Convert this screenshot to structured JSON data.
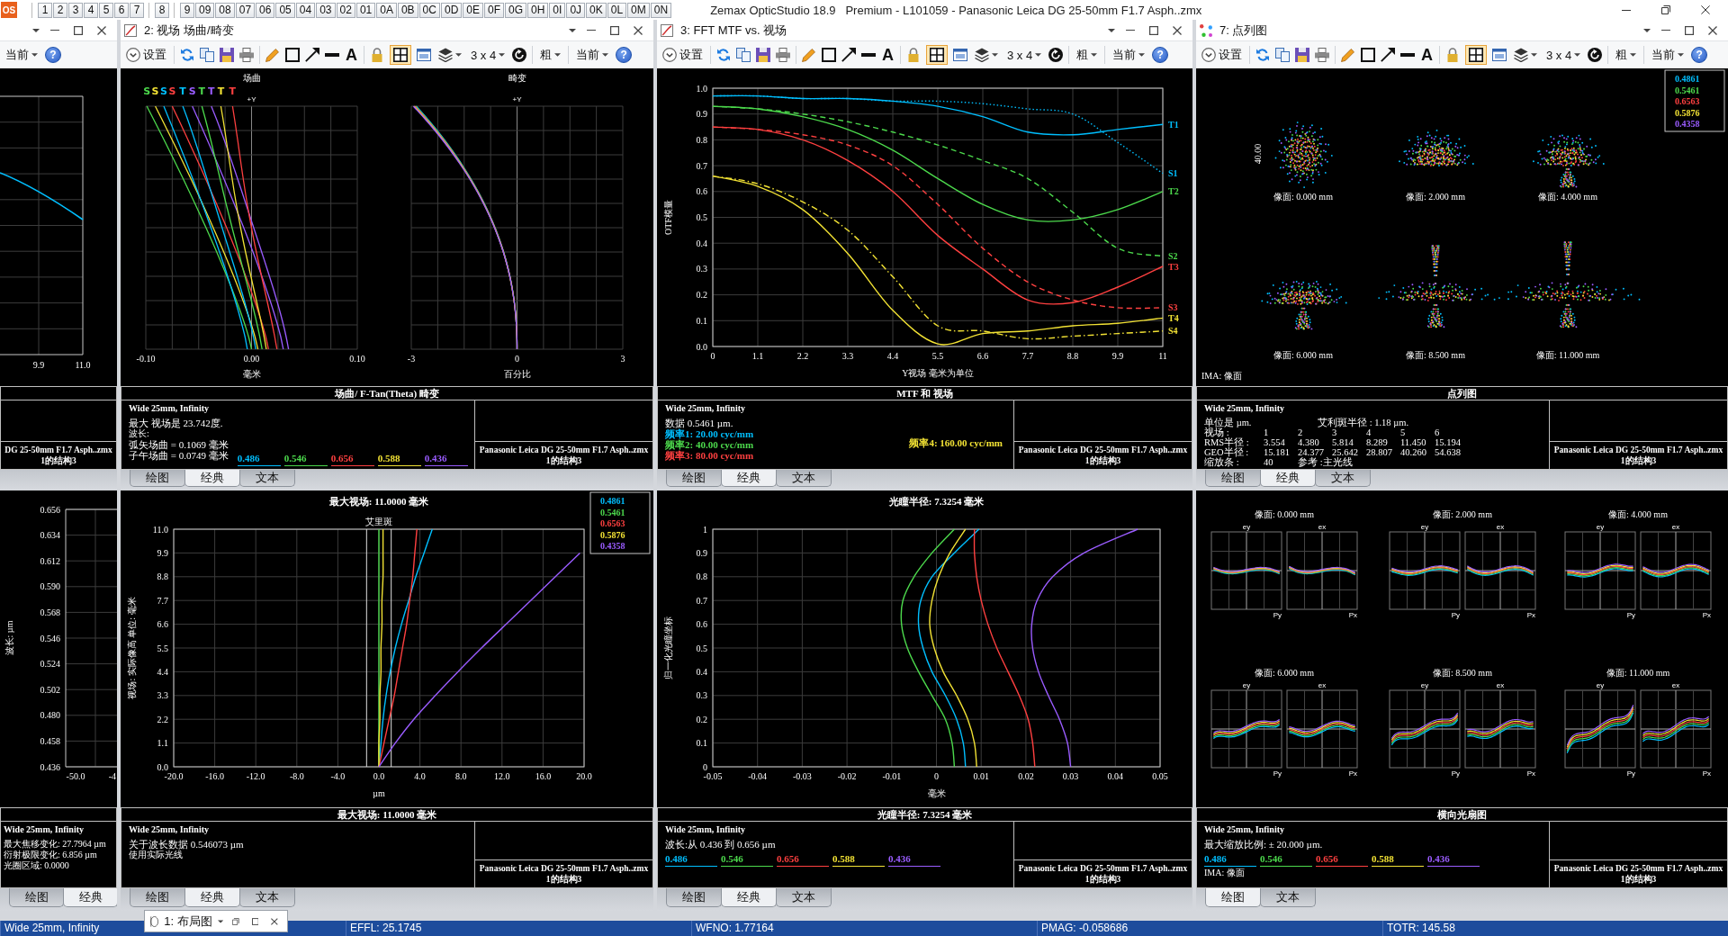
{
  "window": {
    "logo": "OS",
    "title": "Zemax OpticStudio 18.9   Premium - L101059 - Panasonic Leica DG 25-50mm F1.7 Asph..zmx"
  },
  "tab_groups": [
    [
      "1",
      "2",
      "3",
      "4",
      "5",
      "6",
      "7"
    ],
    [
      "8"
    ],
    [
      "9",
      "09",
      "08",
      "07",
      "06",
      "05",
      "04",
      "03",
      "02",
      "01",
      "0A",
      "0B",
      "0C",
      "0D",
      "0E",
      "0F",
      "0G",
      "0H",
      "0I",
      "0J",
      "0K",
      "0L",
      "0M",
      "0N"
    ]
  ],
  "panes": [
    {
      "kind": "with-header",
      "toolbar": {
        "kind": "partial",
        "config": "当前",
        "help": "?"
      },
      "chart": {
        "kind": "partial-curve",
        "curves": [
          {
            "color": "#00bfff"
          }
        ],
        "xticks": [
          "9.9",
          "11.0"
        ]
      },
      "info": {
        "file": "DG 25-50mm F1.7 Asph..zmx",
        "config": "1的结构3"
      }
    },
    {
      "kind": "with-header",
      "title": "2: 视场 场曲/畸变",
      "toolbar": {
        "kind": "full",
        "settings": "设置",
        "text_tool": "A",
        "layout": "3 x 4",
        "weight": "粗",
        "config": "当前",
        "help": "?",
        "snap_on": true
      },
      "chart": {
        "kind": "field-curvature",
        "panels": [
          {
            "title": "场曲",
            "axis": "+Y",
            "xticks": [
              "-0.10",
              "0.00",
              "0.10"
            ],
            "xlabel": "毫米"
          },
          {
            "title": "畸变",
            "axis": "+Y",
            "xticks": [
              "-3",
              "0",
              "3"
            ],
            "xlabel": "百分比"
          }
        ],
        "curves": [
          {
            "label": "S",
            "kind": "sagittal",
            "color": "#4cd94c"
          },
          {
            "label": "S",
            "kind": "sagittal",
            "color": "#f2e234"
          },
          {
            "label": "S",
            "kind": "sagittal",
            "color": "#00bfff"
          },
          {
            "label": "S",
            "kind": "sagittal",
            "color": "#ff4040"
          },
          {
            "label": "T",
            "kind": "tangential",
            "color": "#00bfff"
          },
          {
            "label": "S",
            "kind": "sagittal",
            "color": "#9a5cff"
          },
          {
            "label": "T",
            "kind": "tangential",
            "color": "#4cd94c"
          },
          {
            "label": "T",
            "kind": "tangential",
            "color": "#9a5cff"
          },
          {
            "label": "T",
            "kind": "tangential",
            "color": "#f2e234"
          },
          {
            "label": "T",
            "kind": "tangential",
            "color": "#ff4040"
          }
        ]
      },
      "chart_title": "场曲/ F-Tan(Theta) 畸变",
      "info": {
        "heading": "Wide 25mm, Infinity",
        "lines": [
          {
            "text": "最大 视场是 23.742度.",
            "kind": "normal"
          },
          {
            "text": "波长:",
            "kind": "small"
          },
          {
            "text": "弧矢场曲 = 0.1069 毫米",
            "kind": "normal"
          },
          {
            "text": "子午场曲 = 0.0749 毫米",
            "kind": "normal"
          }
        ],
        "legend": [
          {
            "label": "0.486",
            "color": "#00bfff"
          },
          {
            "label": "0.546",
            "color": "#4cd94c"
          },
          {
            "label": "0.656",
            "color": "#ff4040"
          },
          {
            "label": "0.588",
            "color": "#f2e234"
          },
          {
            "label": "0.436",
            "color": "#9a5cff"
          }
        ],
        "file": "Panasonic Leica DG 25-50mm F1.7 Asph..zmx",
        "config": "1的结构3"
      },
      "tabs": [
        {
          "label": "绘图",
          "selected": false
        },
        {
          "label": "经典",
          "selected": true
        },
        {
          "label": "文本",
          "selected": false
        }
      ]
    },
    {
      "kind": "with-header",
      "title": "3: FFT MTF vs. 视场",
      "toolbar": {
        "kind": "full",
        "settings": "设置",
        "text_tool": "A",
        "layout": "3 x 4",
        "weight": "粗",
        "config": "当前",
        "help": "?",
        "snap_on": true
      },
      "chart": {
        "kind": "mtf",
        "chart_data": {
          "type": "line",
          "xlabel": "Y视场 毫米为单位",
          "ylabel": "OTF模量",
          "grid": true,
          "x": [
            0,
            1.1,
            2.2,
            3.3,
            4.4,
            5.5,
            6.6,
            7.7,
            8.8,
            9.9,
            11
          ],
          "series": [
            {
              "name": "T1",
              "color": "#00bfff",
              "line_style": "solid",
              "values": [
                0.97,
                0.97,
                0.96,
                0.96,
                0.95,
                0.93,
                0.89,
                0.83,
                0.82,
                0.84,
                0.86
              ]
            },
            {
              "name": "S1",
              "color": "#00bfff",
              "line_style": "dotted",
              "values": [
                0.97,
                0.97,
                0.96,
                0.96,
                0.95,
                0.95,
                0.94,
                0.92,
                0.9,
                0.79,
                0.67
              ]
            },
            {
              "name": "T2",
              "color": "#4cd94c",
              "line_style": "solid",
              "values": [
                0.93,
                0.92,
                0.89,
                0.84,
                0.76,
                0.65,
                0.55,
                0.49,
                0.49,
                0.53,
                0.6
              ]
            },
            {
              "name": "S2",
              "color": "#4cd94c",
              "line_style": "dashed",
              "values": [
                0.93,
                0.92,
                0.9,
                0.87,
                0.83,
                0.78,
                0.72,
                0.65,
                0.52,
                0.38,
                0.35
              ]
            },
            {
              "name": "T3",
              "color": "#ff4040",
              "line_style": "solid",
              "values": [
                0.85,
                0.84,
                0.8,
                0.72,
                0.6,
                0.43,
                0.3,
                0.18,
                0.17,
                0.23,
                0.31
              ]
            },
            {
              "name": "S3",
              "color": "#ff4040",
              "line_style": "dashed",
              "values": [
                0.85,
                0.84,
                0.82,
                0.78,
                0.7,
                0.55,
                0.38,
                0.25,
                0.18,
                0.15,
                0.15
              ]
            },
            {
              "name": "T4",
              "color": "#f2e234",
              "line_style": "solid",
              "values": [
                0.66,
                0.62,
                0.53,
                0.36,
                0.14,
                0.01,
                0.05,
                0.06,
                0.08,
                0.09,
                0.11
              ]
            },
            {
              "name": "S4",
              "color": "#f2e234",
              "line_style": "dash-dot",
              "values": [
                0.66,
                0.63,
                0.56,
                0.45,
                0.27,
                0.08,
                0.06,
                0.03,
                0.04,
                0.05,
                0.06
              ]
            }
          ],
          "xlim": [
            0,
            11
          ],
          "ylim": [
            0,
            1
          ],
          "xticks": [
            0,
            1.1,
            2.2,
            3.3,
            4.4,
            5.5,
            6.6,
            7.7,
            8.8,
            9.9,
            11
          ],
          "yticks": [
            {
              "value": 0,
              "label": "0.0"
            },
            0.1,
            0.2,
            0.3,
            0.4,
            0.5,
            0.6,
            0.7,
            0.8,
            0.9,
            {
              "value": 1,
              "label": "1.0"
            }
          ]
        }
      },
      "chart_title": "MTF 和 视场",
      "info": {
        "heading": "Wide 25mm, Infinity",
        "lines": [
          {
            "text": "数据 0.5461 µm.",
            "kind": "normal"
          }
        ],
        "frequencies": [
          {
            "label": "频率1:  20.00 cyc/mm",
            "color": "#00bfff"
          },
          {
            "label": "频率2:  40.00 cyc/mm",
            "color": "#4cd94c"
          },
          {
            "label": "频率3:  80.00 cyc/mm",
            "color": "#ff4040"
          },
          {
            "label": "频率4:  160.00 cyc/mm",
            "color": "#f2e234"
          }
        ],
        "file": "Panasonic Leica DG 25-50mm F1.7 Asph..zmx",
        "config": "1的结构3"
      },
      "tabs": [
        {
          "label": "绘图",
          "selected": false
        },
        {
          "label": "经典",
          "selected": true
        },
        {
          "label": "文本",
          "selected": false
        }
      ]
    },
    {
      "kind": "with-header",
      "title": "7: 点列图",
      "toolbar": {
        "kind": "full",
        "settings": "设置",
        "text_tool": "A",
        "layout": "3 x 4",
        "weight": "粗",
        "config": "当前",
        "help": "?",
        "snap_on": true
      },
      "chart": {
        "kind": "spot",
        "spots": [
          {
            "label": "像面: 0.000 mm"
          },
          {
            "label": "像面: 2.000 mm"
          },
          {
            "label": "像面: 4.000 mm"
          },
          {
            "label": "像面: 6.000 mm"
          },
          {
            "label": "像面: 8.500 mm"
          },
          {
            "label": "像面: 11.000 mm"
          }
        ],
        "scale_label": "40.00",
        "surface_label": "IMA: 像面",
        "legend": [
          {
            "label": "0.4861",
            "color": "#00bfff"
          },
          {
            "label": "0.5461",
            "color": "#4cd94c"
          },
          {
            "label": "0.6563",
            "color": "#ff4040"
          },
          {
            "label": "0.5876",
            "color": "#f2e234"
          },
          {
            "label": "0.4358",
            "color": "#9a5cff"
          }
        ]
      },
      "chart_title": "点列图",
      "info": {
        "heading": "Wide 25mm, Infinity",
        "table": [
          [
            "单位是 µm.",
            "艾利斑半径 : 1.18 µm."
          ],
          [
            "视场 :",
            "1",
            "2",
            "3",
            "4",
            "5",
            "6"
          ],
          [
            "RMS半径 :",
            "3.554",
            "4.380",
            "5.814",
            "8.289",
            "11.450",
            "15.194"
          ],
          [
            "GEO半径 :",
            "15.181",
            "24.377",
            "25.642",
            "28.807",
            "40.260",
            "54.638"
          ],
          [
            "缩放条 :",
            "40",
            "参考 :主光线"
          ]
        ],
        "file": "Panasonic Leica DG 25-50mm F1.7 Asph..zmx",
        "config": "1的结构3"
      },
      "tabs": [
        {
          "label": "绘图",
          "selected": false
        },
        {
          "label": "经典",
          "selected": true
        },
        {
          "label": "文本",
          "selected": false
        }
      ]
    },
    {
      "kind": "plain",
      "chart": {
        "kind": "partial-axis",
        "ylabel": "波长: µm",
        "yticks": [
          "0.656",
          "0.634",
          "0.612",
          "0.590",
          "0.568",
          "0.546",
          "0.524",
          "0.502",
          "0.480",
          "0.458",
          "0.436"
        ],
        "xticks": [
          "-50.0",
          "-4"
        ]
      },
      "info": {
        "heading": "Wide 25mm, Infinity",
        "lines": [
          {
            "text": "最大焦移变化: 27.7964 µm",
            "kind": "normal"
          },
          {
            "text": "衍射极限变化: 6.856 µm",
            "kind": "normal"
          },
          {
            "text": "光圈区域: 0.0000",
            "kind": "normal"
          }
        ]
      },
      "tabs": [
        {
          "label": "绘图",
          "selected": false
        },
        {
          "label": "经典",
          "selected": true
        }
      ]
    },
    {
      "kind": "plain",
      "chart": {
        "kind": "lateral-color",
        "chart_data": {
          "type": "line",
          "orientation": "horizontal",
          "title": "最大视场: 11.0000 毫米",
          "xlabel": "µm",
          "ylabel": "视场: 实际像高 单位: 毫米",
          "grid": true,
          "x": [
            0,
            1.1,
            2.2,
            3.3,
            4.4,
            5.5,
            6.6,
            7.7,
            8.8,
            9.9,
            11
          ],
          "series": [
            {
              "name": "0.4861",
              "color": "#00bfff",
              "values": [
                0,
                0.2,
                0.4,
                0.7,
                1.1,
                1.6,
                2.2,
                2.9,
                3.6,
                4.4,
                5.2
              ]
            },
            {
              "name": "0.5461",
              "color": "#4cd94c",
              "values": [
                0,
                0,
                0,
                0,
                0,
                0,
                0,
                0,
                0,
                0,
                0
              ]
            },
            {
              "name": "0.6563",
              "color": "#ff4040",
              "values": [
                0,
                0.5,
                1.0,
                1.5,
                1.9,
                2.3,
                2.7,
                3.0,
                3.3,
                3.5,
                3.7
              ]
            },
            {
              "name": "0.5876",
              "color": "#f2e234",
              "values": [
                0,
                0,
                0.1,
                0.1,
                0.2,
                0.2,
                0.3,
                0.3,
                0.4,
                0.4,
                0.4
              ]
            },
            {
              "name": "0.4358",
              "color": "#9a5cff",
              "values": [
                0,
                1.6,
                3.4,
                5.5,
                7.7,
                10.0,
                12.4,
                14.8,
                17.2,
                19.6,
                null
              ]
            }
          ],
          "ref_lines": [
            {
              "axis": "x",
              "value": -1.2
            },
            {
              "axis": "x",
              "value": 1.2
            }
          ],
          "annotations": [
            {
              "text": "艾里斑",
              "x": 0,
              "y": 11
            }
          ],
          "xlim": [
            -20,
            20
          ],
          "ylim": [
            0,
            11
          ],
          "xticks": [
            {
              "value": -20,
              "label": "-20.0"
            },
            {
              "value": -16,
              "label": "-16.0"
            },
            {
              "value": -12,
              "label": "-12.0"
            },
            {
              "value": -8,
              "label": "-8.0"
            },
            {
              "value": -4,
              "label": "-4.0"
            },
            {
              "value": 0,
              "label": "0.0"
            },
            {
              "value": 4,
              "label": "4.0"
            },
            {
              "value": 8,
              "label": "8.0"
            },
            {
              "value": 12,
              "label": "12.0"
            },
            {
              "value": 16,
              "label": "16.0"
            },
            {
              "value": 20,
              "label": "20.0"
            }
          ],
          "yticks": [
            {
              "value": 0,
              "label": "0.0"
            },
            1.1,
            2.2,
            3.3,
            4.4,
            5.5,
            6.6,
            7.7,
            8.8,
            9.9,
            {
              "value": 11,
              "label": "11.0"
            }
          ]
        }
      },
      "chart_title": "最大视场: 11.0000 毫米",
      "info": {
        "heading": "Wide 25mm, Infinity",
        "lines": [
          {
            "text": "关于波长数据 0.546073 µm",
            "kind": "normal"
          },
          {
            "text": "使用实际光线",
            "kind": "small"
          }
        ],
        "file": "Panasonic Leica DG 25-50mm F1.7 Asph..zmx",
        "config": "1的结构3"
      },
      "tabs": [
        {
          "label": "绘图",
          "selected": false
        },
        {
          "label": "经典",
          "selected": true
        },
        {
          "label": "文本",
          "selected": false
        }
      ]
    },
    {
      "kind": "plain",
      "chart": {
        "kind": "longitudinal",
        "chart_data": {
          "type": "line",
          "orientation": "horizontal",
          "title": "光瞳半径: 7.3254 毫米",
          "xlabel": "毫米",
          "ylabel": "归一化光瞳坐标",
          "grid": true,
          "x": [
            0,
            0.1,
            0.2,
            0.3,
            0.4,
            0.5,
            0.6,
            0.7,
            0.8,
            0.9,
            1
          ],
          "series": [
            {
              "color": "#00bfff",
              "values": [
                0.0065,
                0.006,
                0.0045,
                0.002,
                -0.001,
                -0.003,
                -0.004,
                -0.0035,
                -0.001,
                0.004,
                0.0095
              ]
            },
            {
              "color": "#4cd94c",
              "values": [
                0.004,
                0.0035,
                0.002,
                -0.001,
                -0.004,
                -0.0065,
                -0.0078,
                -0.0075,
                -0.005,
                -0.001,
                0.004
              ]
            },
            {
              "color": "#ff4040",
              "values": [
                0.022,
                0.0215,
                0.0205,
                0.0185,
                0.016,
                0.0135,
                0.0115,
                0.01,
                0.009,
                0.0085,
                0.0085
              ]
            },
            {
              "color": "#f2e234",
              "values": [
                0.009,
                0.0085,
                0.007,
                0.0045,
                0.0015,
                -0.0005,
                -0.0015,
                -0.001,
                0.0005,
                0.003,
                0.0065
              ]
            },
            {
              "color": "#9a5cff",
              "values": [
                0.03,
                0.0293,
                0.0275,
                0.025,
                0.0228,
                0.0215,
                0.0213,
                0.0225,
                0.026,
                0.033,
                0.045
              ]
            }
          ],
          "xlim": [
            -0.05,
            0.05
          ],
          "ylim": [
            0,
            1
          ],
          "xticks": [
            -0.05,
            -0.04,
            -0.03,
            -0.02,
            -0.01,
            0,
            0.01,
            0.02,
            0.03,
            0.04,
            0.05
          ],
          "yticks": [
            0,
            0.1,
            0.2,
            0.3,
            0.4,
            0.5,
            0.6,
            0.7,
            0.8,
            0.9,
            1
          ]
        }
      },
      "chart_title": "光瞳半径: 7.3254 毫米",
      "info": {
        "heading": "Wide 25mm, Infinity",
        "lines": [
          {
            "text": "波长:从 0.436 到 0.656 µm",
            "kind": "normal"
          }
        ],
        "legend": [
          {
            "label": "0.486",
            "color": "#00bfff"
          },
          {
            "label": "0.546",
            "color": "#4cd94c"
          },
          {
            "label": "0.656",
            "color": "#ff4040"
          },
          {
            "label": "0.588",
            "color": "#f2e234"
          },
          {
            "label": "0.436",
            "color": "#9a5cff"
          }
        ],
        "file": "Panasonic Leica DG 25-50mm F1.7 Asph..zmx",
        "config": "1的结构3"
      },
      "tabs": [
        {
          "label": "绘图",
          "selected": false
        },
        {
          "label": "经典",
          "selected": true
        },
        {
          "label": "文本",
          "selected": false
        }
      ]
    },
    {
      "kind": "plain",
      "chart": {
        "kind": "ray-fan",
        "fans": [
          {
            "label": "像面: 0.000 mm",
            "plots": [
              {
                "axis": "ey",
                "pupil": "Py"
              },
              {
                "axis": "ex",
                "pupil": "Px"
              }
            ]
          },
          {
            "label": "像面: 2.000 mm",
            "plots": [
              {
                "axis": "ey",
                "pupil": "Py"
              },
              {
                "axis": "ex",
                "pupil": "Px"
              }
            ]
          },
          {
            "label": "像面: 4.000 mm",
            "plots": [
              {
                "axis": "ey",
                "pupil": "Py"
              },
              {
                "axis": "ex",
                "pupil": "Px"
              }
            ]
          },
          {
            "label": "像面: 6.000 mm",
            "plots": [
              {
                "axis": "ey",
                "pupil": "Py"
              },
              {
                "axis": "ex",
                "pupil": "Px"
              }
            ]
          },
          {
            "label": "像面: 8.500 mm",
            "plots": [
              {
                "axis": "ey",
                "pupil": "Py"
              },
              {
                "axis": "ex",
                "pupil": "Px"
              }
            ]
          },
          {
            "label": "像面: 11.000 mm",
            "plots": [
              {
                "axis": "ey",
                "pupil": "Py"
              },
              {
                "axis": "ex",
                "pupil": "Px"
              }
            ]
          }
        ]
      },
      "chart_title": "横向光扇图",
      "info": {
        "heading": "Wide 25mm, Infinity",
        "lines": [
          {
            "text": "最大缩放比例: ± 20.000 µm.",
            "kind": "normal"
          }
        ],
        "legend": [
          {
            "label": "0.486",
            "color": "#00bfff"
          },
          {
            "label": "0.546",
            "color": "#4cd94c"
          },
          {
            "label": "0.656",
            "color": "#ff4040"
          },
          {
            "label": "0.588",
            "color": "#f2e234"
          },
          {
            "label": "0.436",
            "color": "#9a5cff"
          }
        ],
        "footer": "IMA: 像面",
        "file": "Panasonic Leica DG 25-50mm F1.7 Asph..zmx",
        "config": "1的结构3"
      },
      "tabs": [
        {
          "label": "绘图",
          "selected": true
        },
        {
          "label": "文本",
          "selected": false
        }
      ]
    }
  ],
  "floating_window": {
    "title": "1: 布局图"
  },
  "status_bar": [
    "Wide 25mm, Infinity",
    "EFFL: 25.1745",
    "WFNO: 1.77164",
    "PMAG: -0.058686",
    "TOTR: 145.58"
  ]
}
